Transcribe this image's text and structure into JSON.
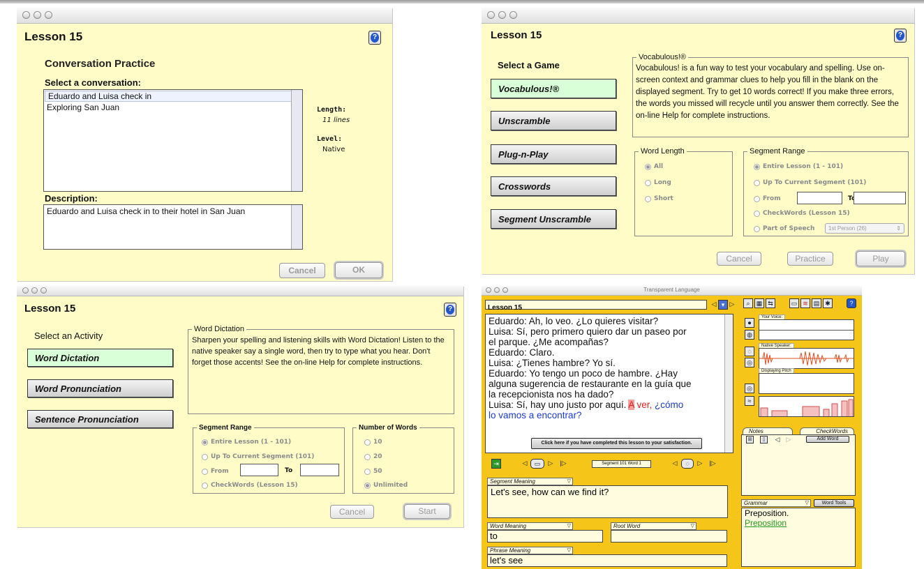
{
  "w1": {
    "lesson_title": "Lesson 15",
    "heading": "Conversation Practice",
    "select_label": "Select a conversation:",
    "conversations": [
      "Eduardo and Luisa check in",
      "Exploring San Juan"
    ],
    "length_label": "Length:",
    "length_value": "11 lines",
    "level_label": "Level:",
    "level_value": "Native",
    "description_label": "Description:",
    "description_text": "Eduardo and Luisa check in to their hotel in San Juan",
    "cancel_label": "Cancel",
    "ok_label": "OK"
  },
  "w2": {
    "lesson_title": "Lesson 15",
    "select_game_label": "Select a Game",
    "games": [
      "Vocabulous!®",
      "Unscramble",
      "Plug-n-Play",
      "Crosswords",
      "Segment Unscramble"
    ],
    "group_title": "Vocabulous!®",
    "description": "Vocabulous! is a fun way to test your vocabulary and spelling. Use on-screen context and grammar clues to help you fill in the blank on the displayed segment. Try to get 10 words correct! If you make three errors, the words you missed will recycle until you answer them correctly. See the on-line Help for complete instructions.",
    "word_length_title": "Word Length",
    "word_length_options": [
      "All",
      "Long",
      "Short"
    ],
    "segment_range_title": "Segment Range",
    "range_entire": "Entire Lesson (1 - 101)",
    "range_current": "Up To Current Segment (101)",
    "range_from": "From",
    "range_to": "To",
    "range_checkwords": "CheckWords (Lesson 15)",
    "range_pos": "Part of Speech",
    "pos_value": "1st Person (26)",
    "cancel_label": "Cancel",
    "practice_label": "Practice",
    "play_label": "Play"
  },
  "w3": {
    "lesson_title": "Lesson 15",
    "select_activity_label": "Select an Activity",
    "activities": [
      "Word Dictation",
      "Word Pronunciation",
      "Sentence Pronunciation"
    ],
    "group_title": "Word Dictation",
    "description": "Sharpen your spelling and listening skills with Word Dictation! Listen to the native speaker say a single word, then try to type what you hear. Don't forget those accents! See the on-line Help for complete instructions.",
    "segment_range_title": "Segment Range",
    "range_entire": "Entire Lesson (1 - 101)",
    "range_current": "Up To Current Segment (101)",
    "range_from": "From",
    "range_to": "To",
    "range_checkwords": "CheckWords (Lesson 15)",
    "num_words_title": "Number of Words",
    "num_words_options": [
      "10",
      "20",
      "50",
      "Unlimited"
    ],
    "cancel_label": "Cancel",
    "start_label": "Start"
  },
  "w4": {
    "window_title": "Transparent Language",
    "lesson_title": "Lesson 15",
    "lines": [
      "Eduardo: Ah, lo veo. ¿Lo quieres visitar?",
      "Luisa: Sí, pero primero quiero dar un paseo por",
      "el parque. ¿Me acompañas?",
      "Eduardo: Claro.",
      "Luisa: ¿Tienes hambre? Yo sí.",
      "Eduardo: Yo tengo un poco de hambre. ¿Hay",
      "alguna sugerencia de restaurante en la guía que",
      "la recepcionista nos ha dado?"
    ],
    "last_line_prefix": "Luisa: Sí, hay uno justo por aquí.",
    "last_line_word_a": "A",
    "last_line_word_ver": "ver,",
    "last_line_rest": "¿cómo",
    "last_line_cont": "lo vamos a encontrar?",
    "complete_button": "Click here if you have completed this lesson to your satisfaction.",
    "segment_label": "Segment 101  Word 1",
    "your_voice_label": "Your Voice:",
    "native_speaker_label": "Native Speaker:",
    "displaying_pitch_label": "Displaying Pitch",
    "notes_tab": "Notes",
    "checkwords_tab": "CheckWords",
    "add_word_label": "Add Word",
    "segment_meaning_label": "Segment Meaning",
    "segment_meaning_text": "Let's see, how can we find it?",
    "word_meaning_label": "Word Meaning",
    "word_meaning_text": "to",
    "root_word_label": "Root Word",
    "root_word_text": "",
    "phrase_meaning_label": "Phrase Meaning",
    "phrase_meaning_text": "let's see",
    "grammar_label": "Grammar",
    "word_tools_label": "Word Tools",
    "grammar_text": "Preposition.",
    "grammar_link": "Preposition",
    "colors": {
      "panel": "#f5c51a",
      "link": "#1e9a1e"
    }
  }
}
